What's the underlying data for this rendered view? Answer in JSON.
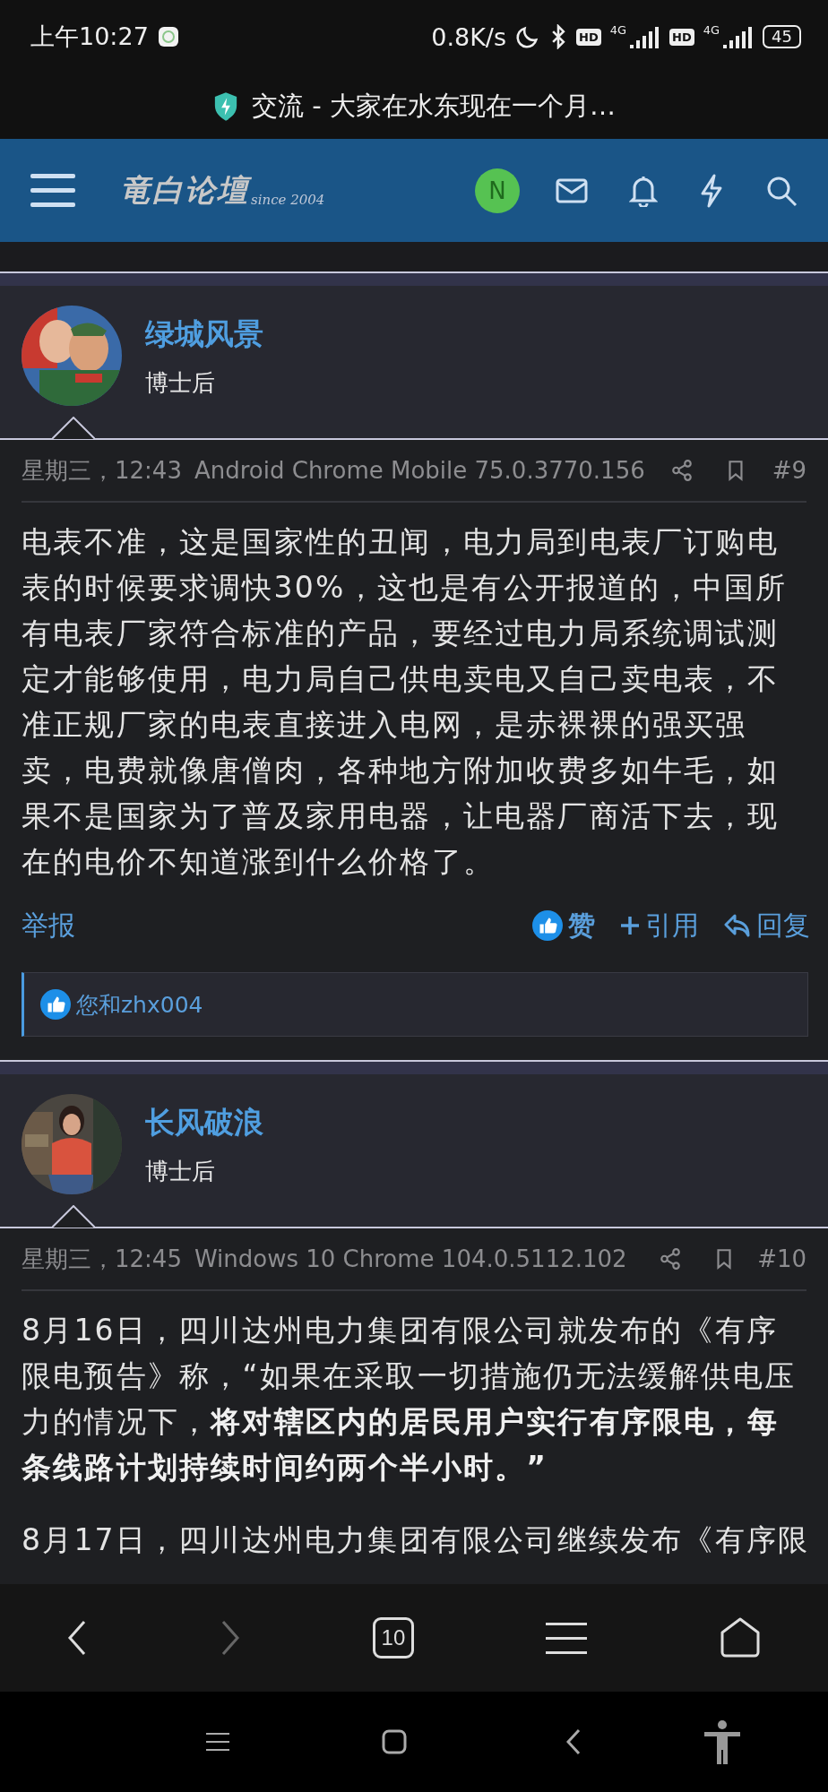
{
  "status_bar": {
    "time": "上午10:27",
    "speed": "0.8K/s",
    "sims": [
      {
        "hd": "HD",
        "network": "4G"
      },
      {
        "hd": "HD",
        "network": "4G"
      }
    ],
    "battery": "45"
  },
  "tab_title": "交流 - 大家在水东现在一个月…",
  "header": {
    "logo": "竜白论壇",
    "logo_since": "since 2004",
    "avatar_letter": "N"
  },
  "posts": [
    {
      "author": "绿城风景",
      "rank": "博士后",
      "date": "星期三，12:43",
      "device": "Android Chrome Mobile 75.0.3770.156",
      "number": "#9",
      "paragraphs": [
        "电表不准，这是国家性的丑闻，电力局到电表厂订购电表的时候要求调快30%，这也是有公开报道的，中国所有电表厂家符合标准的产品，要经过电力局系统调试测定才能够使用，电力局自己供电卖电又自己卖电表，不准正规厂家的电表直接进入电网，是赤裸裸的强买强卖，电费就像唐僧肉，各种地方附加收费多如牛毛，如果不是国家为了普及家用电器，让电器厂商活下去，现在的电价不知道涨到什么价格了。"
      ],
      "footer": {
        "report": "举报",
        "like": {
          "label": "赞",
          "selected": true
        },
        "quote": "引用",
        "reply": "回复",
        "likes_summary": "您和zhx004"
      }
    },
    {
      "author": "长风破浪",
      "rank": "博士后",
      "date": "星期三，12:45",
      "device": "Windows 10 Chrome 104.0.5112.102",
      "number": "#10",
      "paragraphs": [
        "8月16日，四川达州电力集团有限公司就发布的《有序限电预告》称，“如果在采取一切措施仍无法缓解供电压力的情况下，**将对辖区内的居民用户实行有序限电，每条线路计划持续时间约两个半小时。”**",
        "8月17日，四川达州电力集团有限公司继续发布《有序限"
      ]
    }
  ],
  "browser_bar": {
    "back_disabled": false,
    "forward_disabled": true,
    "tab_count": "10"
  }
}
